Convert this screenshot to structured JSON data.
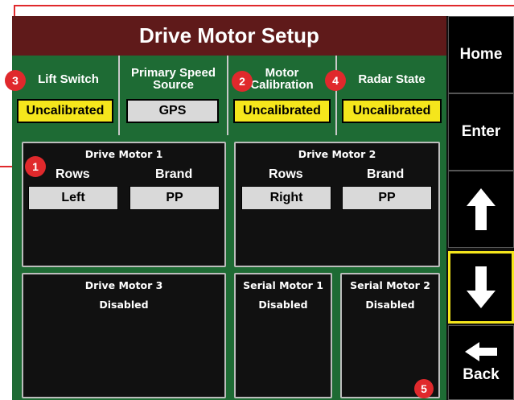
{
  "screen": {
    "title": "Drive Motor Setup"
  },
  "status": [
    {
      "label": "Lift Switch",
      "value": "Uncalibrated"
    },
    {
      "label": "Primary Speed\nSource",
      "value": "GPS"
    },
    {
      "label": "Motor\nCalibration",
      "value": "Uncalibrated"
    },
    {
      "label": "Radar State",
      "value": "Uncalibrated"
    }
  ],
  "motors": {
    "motor1": {
      "title": "Drive Motor 1",
      "rows_label": "Rows",
      "brand_label": "Brand",
      "rows_value": "Left",
      "brand_value": "PP"
    },
    "motor2": {
      "title": "Drive Motor 2",
      "rows_label": "Rows",
      "brand_label": "Brand",
      "rows_value": "Right",
      "brand_value": "PP"
    },
    "motor3": {
      "title": "Drive Motor 3",
      "status": "Disabled"
    },
    "serial1": {
      "title": "Serial Motor 1",
      "status": "Disabled"
    },
    "serial2": {
      "title": "Serial Motor 2",
      "status": "Disabled"
    }
  },
  "nav": {
    "home": "Home",
    "enter": "Enter",
    "up_icon": "arrow-up-icon",
    "down_icon": "arrow-down-icon",
    "back_icon": "arrow-left-icon",
    "back": "Back"
  },
  "callouts": [
    "1",
    "2",
    "3",
    "4",
    "5"
  ],
  "colors": {
    "title_bg": "#5f1a1a",
    "panel_green": "#1e6b34",
    "uncalibrated_yellow": "#f5e61c",
    "value_gray": "#d9d9d9",
    "callout_red": "#e0292c",
    "selected_border": "#f5e61c"
  }
}
